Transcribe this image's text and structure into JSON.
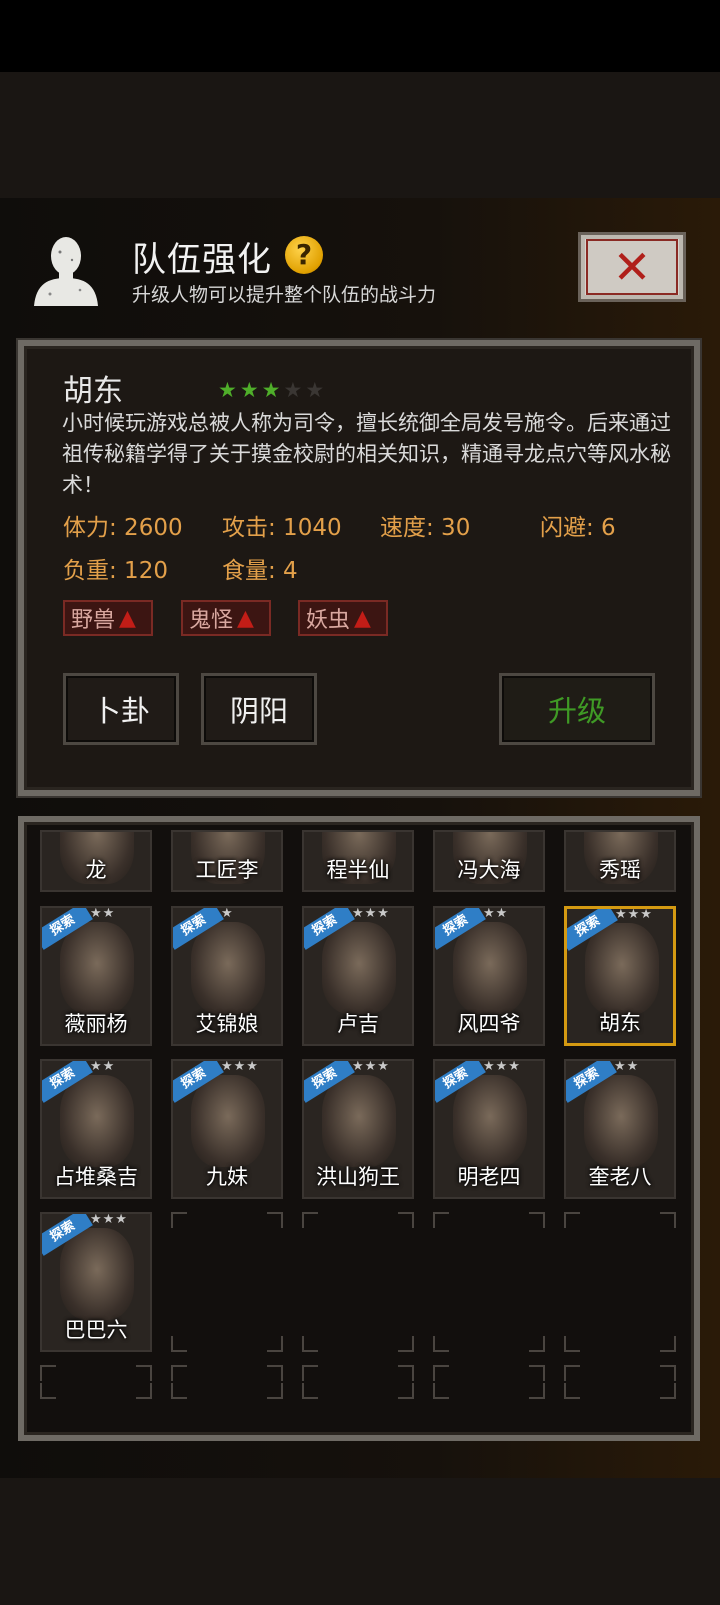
{
  "header": {
    "title": "队伍强化",
    "help_icon": "?",
    "subtitle": "升级人物可以提升整个队伍的战斗力",
    "close_icon": "✕"
  },
  "character": {
    "name": "胡东",
    "stars": 3,
    "max_stars": 5,
    "description": "小时候玩游戏总被人称为司令，擅长统御全局发号施令。后来通过祖传秘籍学得了关于摸金校尉的相关知识，精通寻龙点穴等风水秘术！",
    "stats": {
      "stamina": "体力: 2600",
      "attack": "攻击: 1040",
      "speed": "速度: 30",
      "dodge": "闪避: 6",
      "load": "负重: 120",
      "food": "食量: 4"
    },
    "tags": [
      {
        "label": "野兽",
        "icon": "up-arrow-icon"
      },
      {
        "label": "鬼怪",
        "icon": "up-arrow-icon"
      },
      {
        "label": "妖虫",
        "icon": "up-arrow-icon"
      }
    ]
  },
  "buttons": {
    "divination": "卜卦",
    "yinyang": "阴阳",
    "upgrade": "升级"
  },
  "roster": {
    "row0": [
      "龙",
      "工匠李",
      "程半仙",
      "冯大海",
      "秀瑶"
    ],
    "row1": [
      {
        "name": "薇丽杨",
        "badge": "探索",
        "stars": "★★"
      },
      {
        "name": "艾锦娘",
        "badge": "探索",
        "stars": "★"
      },
      {
        "name": "卢吉",
        "badge": "探索",
        "stars": "★★★"
      },
      {
        "name": "风四爷",
        "badge": "探索",
        "stars": "★★"
      },
      {
        "name": "胡东",
        "badge": "探索",
        "stars": "★★★"
      }
    ],
    "row2": [
      {
        "name": "占堆桑吉",
        "badge": "探索",
        "stars": "★★"
      },
      {
        "name": "九妹",
        "badge": "探索",
        "stars": "★★★"
      },
      {
        "name": "洪山狗王",
        "badge": "探索",
        "stars": "★★★"
      },
      {
        "name": "明老四",
        "badge": "探索",
        "stars": "★★★"
      },
      {
        "name": "奎老八",
        "badge": "探索",
        "stars": "★★"
      }
    ],
    "row3": [
      {
        "name": "巴巴六",
        "badge": "探索",
        "stars": "★★★"
      }
    ]
  }
}
